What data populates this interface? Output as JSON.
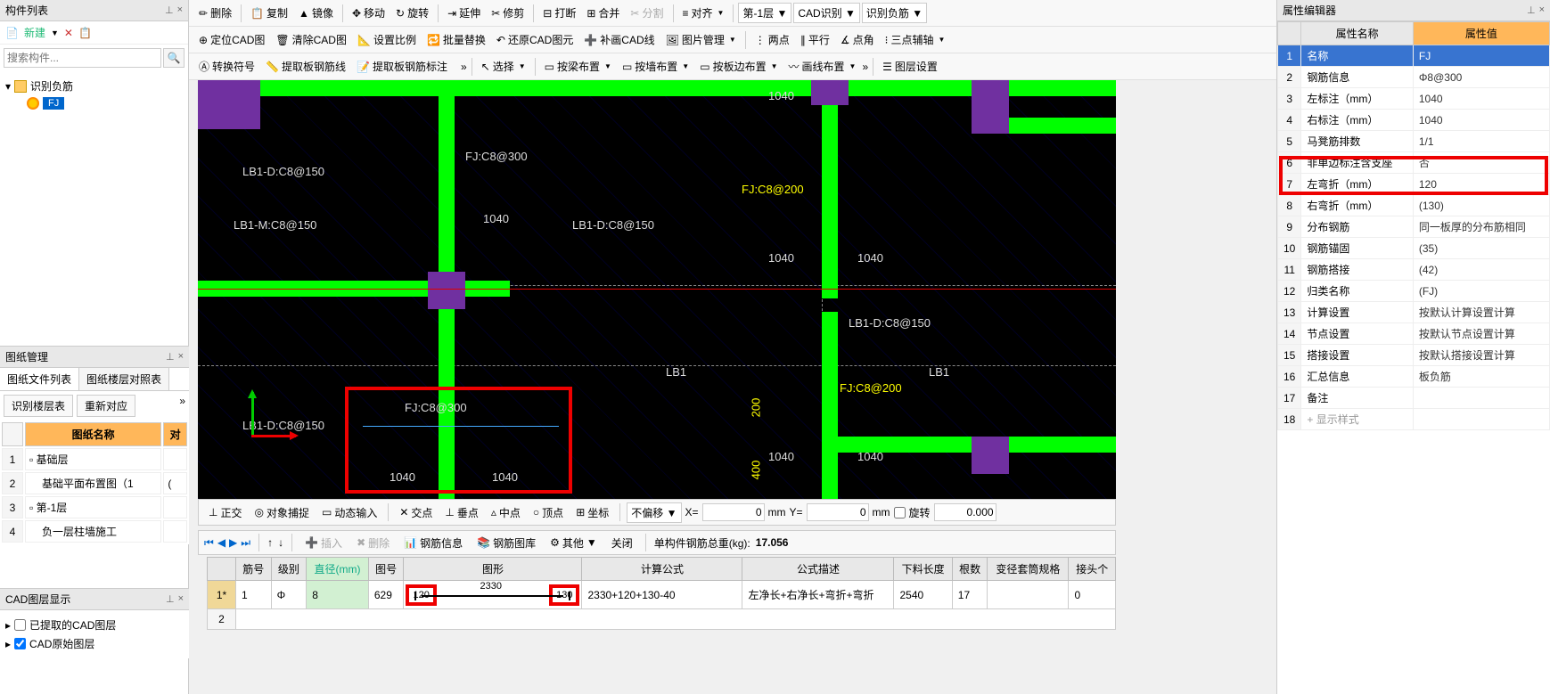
{
  "left": {
    "list_title": "构件列表",
    "new_label": "新建",
    "search_placeholder": "搜索构件...",
    "tree_root": "识别负筋",
    "tree_leaf": "FJ",
    "drawing_title": "图纸管理",
    "tab_file_list": "图纸文件列表",
    "tab_floor_compare": "图纸楼层对照表",
    "sub_tab1": "识别楼层表",
    "sub_tab2": "重新对应",
    "th_name": "图纸名称",
    "th_compare": "对",
    "rows": [
      {
        "n": "1",
        "name": "基础层"
      },
      {
        "n": "2",
        "name": "基础平面布置图（1"
      },
      {
        "n": "3",
        "name": "第-1层"
      },
      {
        "n": "4",
        "name": "负一层柱墙施工"
      }
    ],
    "layer_title": "CAD图层显示",
    "layer_extracted": "已提取的CAD图层",
    "layer_raw": "CAD原始图层"
  },
  "toolbar": {
    "r1": {
      "delete": "删除",
      "copy": "复制",
      "mirror": "镜像",
      "move": "移动",
      "rotate": "旋转",
      "extend": "延伸",
      "trim": "修剪",
      "break": "打断",
      "merge": "合并",
      "split": "分割",
      "align": "对齐",
      "layer_sel": "第-1层",
      "cad_rec": "CAD识别",
      "rec_neg": "识别负筋"
    },
    "r2": {
      "locate": "定位CAD图",
      "clear": "清除CAD图",
      "scale": "设置比例",
      "batch": "批量替换",
      "restore": "还原CAD图元",
      "fill": "补画CAD线",
      "img": "图片管理",
      "two": "两点",
      "parallel": "平行",
      "angle": "点角",
      "aux": "三点辅轴"
    },
    "r3": {
      "convert": "转换符号",
      "extract1": "提取板钢筋线",
      "extract2": "提取板钢筋标注",
      "select": "选择",
      "layout_beam": "按梁布置",
      "layout_wall": "按墙布置",
      "layout_slab": "按板边布置",
      "layout_line": "画线布置",
      "layer_set": "图层设置"
    }
  },
  "status": {
    "ortho": "正交",
    "snap": "对象捕捉",
    "dyn": "动态输入",
    "cross": "交点",
    "perp": "垂点",
    "mid": "中点",
    "peak": "顶点",
    "坐标": "坐标",
    "offset": "不偏移",
    "x_lbl": "X=",
    "x_val": "0",
    "mm": "mm",
    "y_lbl": "Y=",
    "y_val": "0",
    "rotate": "旋转",
    "rot_val": "0.000"
  },
  "rebar_tb": {
    "insert": "插入",
    "delete": "删除",
    "info": "钢筋信息",
    "lib": "钢筋图库",
    "other": "其他",
    "close": "关闭",
    "weight_lbl": "单构件钢筋总重(kg):",
    "weight": "17.056"
  },
  "rebar_table": {
    "h_num": "筋号",
    "h_grade": "级别",
    "h_dia": "直径(mm)",
    "h_sym": "图号",
    "h_shape": "图形",
    "h_formula": "计算公式",
    "h_desc": "公式描述",
    "h_cut": "下料长度",
    "h_count": "根数",
    "h_spec": "变径套筒规格",
    "h_joint": "接头个",
    "row1": {
      "rn": "1*",
      "num": "1",
      "grade": "Φ",
      "dia": "8",
      "sym": "629",
      "s_left": "120",
      "s_mid": "2330",
      "s_right": "130",
      "formula": "2330+120+130-40",
      "desc": "左净长+右净长+弯折+弯折",
      "cut": "2540",
      "count": "17",
      "spec": "",
      "joint": "0"
    },
    "row2_rn": "2"
  },
  "canvas": {
    "lb1d": "LB1-D:C8@150",
    "lb1m": "LB1-M:C8@150",
    "fj300": "FJ:C8@300",
    "fj200": "FJ:C8@200",
    "lb1": "LB1",
    "d1040": "1040",
    "d200": "200",
    "d400": "400",
    "fj_area": "FJ:C8@300"
  },
  "prop": {
    "title": "属性编辑器",
    "th_name": "属性名称",
    "th_val": "属性值",
    "rows": [
      {
        "n": "1",
        "name": "名称",
        "val": "FJ",
        "sel": true
      },
      {
        "n": "2",
        "name": "钢筋信息",
        "val": "Φ8@300"
      },
      {
        "n": "3",
        "name": "左标注（mm）",
        "val": "1040"
      },
      {
        "n": "4",
        "name": "右标注（mm）",
        "val": "1040"
      },
      {
        "n": "5",
        "name": "马凳筋排数",
        "val": "1/1"
      },
      {
        "n": "6",
        "name": "非单边标注含支座",
        "val": "否"
      },
      {
        "n": "7",
        "name": "左弯折（mm）",
        "val": "120",
        "hl": true
      },
      {
        "n": "8",
        "name": "右弯折（mm）",
        "val": "(130)",
        "hl": true
      },
      {
        "n": "9",
        "name": "分布钢筋",
        "val": "同一板厚的分布筋相同"
      },
      {
        "n": "10",
        "name": "钢筋锚固",
        "val": "(35)"
      },
      {
        "n": "11",
        "name": "钢筋搭接",
        "val": "(42)"
      },
      {
        "n": "12",
        "name": "归类名称",
        "val": "(FJ)"
      },
      {
        "n": "13",
        "name": "计算设置",
        "val": "按默认计算设置计算"
      },
      {
        "n": "14",
        "name": "节点设置",
        "val": "按默认节点设置计算"
      },
      {
        "n": "15",
        "name": "搭接设置",
        "val": "按默认搭接设置计算"
      },
      {
        "n": "16",
        "name": "汇总信息",
        "val": "板负筋"
      },
      {
        "n": "17",
        "name": "备注",
        "val": ""
      },
      {
        "n": "18",
        "name": "显示样式",
        "val": "",
        "gray": true,
        "plus": true
      }
    ]
  }
}
